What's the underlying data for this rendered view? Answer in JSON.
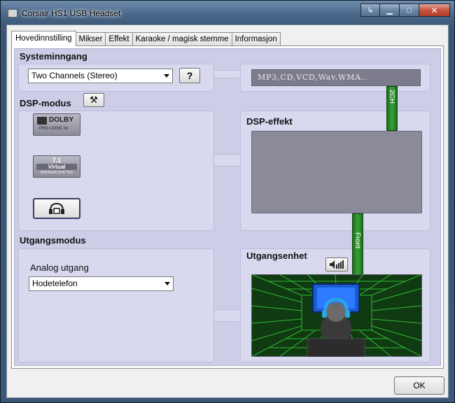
{
  "window": {
    "title": "Corsair HS1 USB Headset"
  },
  "tabs": [
    {
      "label": "Hovedinnstilling"
    },
    {
      "label": "Mikser"
    },
    {
      "label": "Effekt"
    },
    {
      "label": "Karaoke / magisk stemme"
    },
    {
      "label": "Informasjon"
    }
  ],
  "system_input": {
    "label": "Systeminngang",
    "channel_value": "Two Channels (Stereo)",
    "help_label": "?",
    "formats": "MP3,CD,VCD,Wav,WMA.."
  },
  "dsp": {
    "label": "DSP-modus",
    "dolby_brand": "DOLBY",
    "dolby_sub": "PRO LOGIC IIx",
    "virtual_num": "7.1",
    "virtual_word": "Virtual",
    "virtual_sub": "SPEAKER SHIFTER",
    "effect_label": "DSP-effekt",
    "channel_tag": "2CH"
  },
  "output": {
    "label": "Utgangsmodus",
    "analog_label": "Analog utgang",
    "analog_value": "Hodetelefon",
    "device_label": "Utgangsenhet",
    "front_tag": "Front"
  },
  "footer": {
    "ok_label": "OK"
  }
}
